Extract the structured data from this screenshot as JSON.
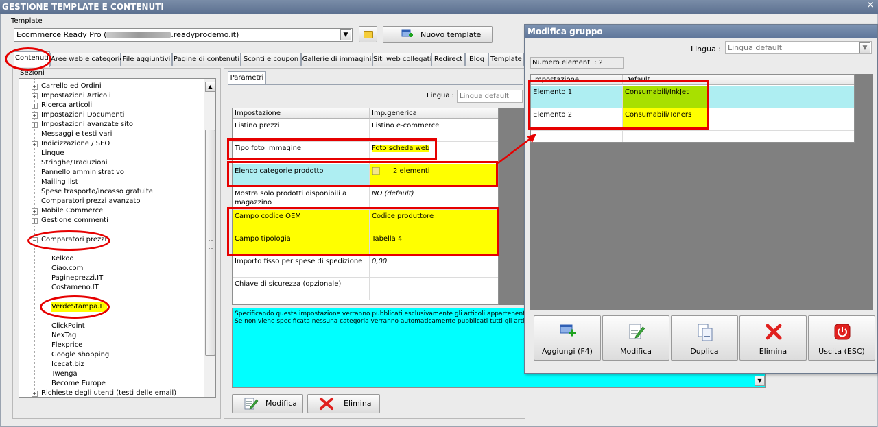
{
  "window": {
    "title": "GESTIONE TEMPLATE E CONTENUTI",
    "close": "×"
  },
  "template": {
    "label": "Template",
    "value_prefix": "Ecommerce Ready Pro (",
    "value_suffix": ".readyprodemo.it)",
    "new_button": "Nuovo template"
  },
  "tabs": [
    {
      "label": "Contenuti"
    },
    {
      "label": "Aree web e categorie"
    },
    {
      "label": "File aggiuntivi"
    },
    {
      "label": "Pagine di contenuti"
    },
    {
      "label": "Sconti e coupon"
    },
    {
      "label": "Gallerie di immagini"
    },
    {
      "label": "Siti web collegati"
    },
    {
      "label": "Redirect"
    },
    {
      "label": "Blog"
    },
    {
      "label": "Template"
    }
  ],
  "sections": {
    "label": "Sezioni",
    "items": [
      {
        "label": "Carrello ed Ordini"
      },
      {
        "label": "Impostazioni Articoli"
      },
      {
        "label": "Ricerca articoli"
      },
      {
        "label": "Impostazioni Documenti"
      },
      {
        "label": "Impostazioni avanzate sito"
      },
      {
        "label": "Messaggi e testi vari"
      },
      {
        "label": "Indicizzazione / SEO"
      },
      {
        "label": "Lingue"
      },
      {
        "label": "Stringhe/Traduzioni"
      },
      {
        "label": "Pannello amministrativo"
      },
      {
        "label": "Mailing list"
      },
      {
        "label": "Spese trasporto/incasso gratuite"
      },
      {
        "label": "Comparatori prezzi avanzato"
      },
      {
        "label": "Mobile Commerce"
      },
      {
        "label": "Gestione commenti"
      },
      {
        "label": "Comparatori prezzi"
      },
      {
        "label": "Kelkoo"
      },
      {
        "label": "Ciao.com"
      },
      {
        "label": "Pagineprezzi.IT"
      },
      {
        "label": "Costameno.IT"
      },
      {
        "label": "VerdeStampa.IT"
      },
      {
        "label": "ClickPoint"
      },
      {
        "label": "NexTag"
      },
      {
        "label": "Flexprice"
      },
      {
        "label": "Google shopping"
      },
      {
        "label": "Icecat.biz"
      },
      {
        "label": "Twenga"
      },
      {
        "label": "Become Europe"
      },
      {
        "label": "Richieste degli utenti (testi delle email)"
      }
    ]
  },
  "params": {
    "tab": "Parametri",
    "lingua_label": "Lingua :",
    "lingua_value": "Lingua default",
    "headers": [
      "Impostazione",
      "Imp.generica"
    ],
    "rows": [
      {
        "name": "Listino prezzi",
        "value": "Listino e-commerce"
      },
      {
        "name": "Tipo foto immagine",
        "value": "Foto scheda web"
      },
      {
        "name": "Elenco categorie prodotto",
        "value": "2 elementi"
      },
      {
        "name": "Mostra solo prodotti disponibili a magazzino",
        "value": "NO (default)"
      },
      {
        "name": "Campo codice OEM",
        "value": "Codice produttore"
      },
      {
        "name": "Campo tipologia",
        "value": "Tabella 4"
      },
      {
        "name": "Importo fisso per spese di spedizione",
        "value": "0,00"
      },
      {
        "name": "Chiave di sicurezza (opzionale)",
        "value": ""
      }
    ],
    "description_line1": "Specificando questa impostazione verranno pubblicati esclusivamente gli articoli appartenenti al",
    "description_line2": "Se non viene specificata nessuna categoria verranno automaticamente pubblicati tutti gli articoli",
    "modify_button": "Modifica",
    "delete_button": "Elimina"
  },
  "dialog": {
    "title": "Modifica gruppo",
    "lingua_label": "Lingua :",
    "lingua_value": "Lingua default",
    "count": "Numero elementi : 2",
    "headers": [
      "Impostazione",
      "Default"
    ],
    "rows": [
      {
        "name": "Elemento 1",
        "value": "Consumabili/InkJet"
      },
      {
        "name": "Elemento 2",
        "value": "Consumabili/Toners"
      }
    ],
    "buttons": {
      "add": "Aggiungi (F4)",
      "modify": "Modifica",
      "duplicate": "Duplica",
      "delete": "Elimina",
      "exit": "Uscita (ESC)"
    }
  },
  "colors": {
    "highlight_yellow": "#ffff00",
    "highlight_cyan": "#aeeef2",
    "highlight_green": "#a8e000",
    "annotation_red": "#e60000",
    "description_bg": "#00ffff",
    "titlebar": "#6a7f9f"
  }
}
